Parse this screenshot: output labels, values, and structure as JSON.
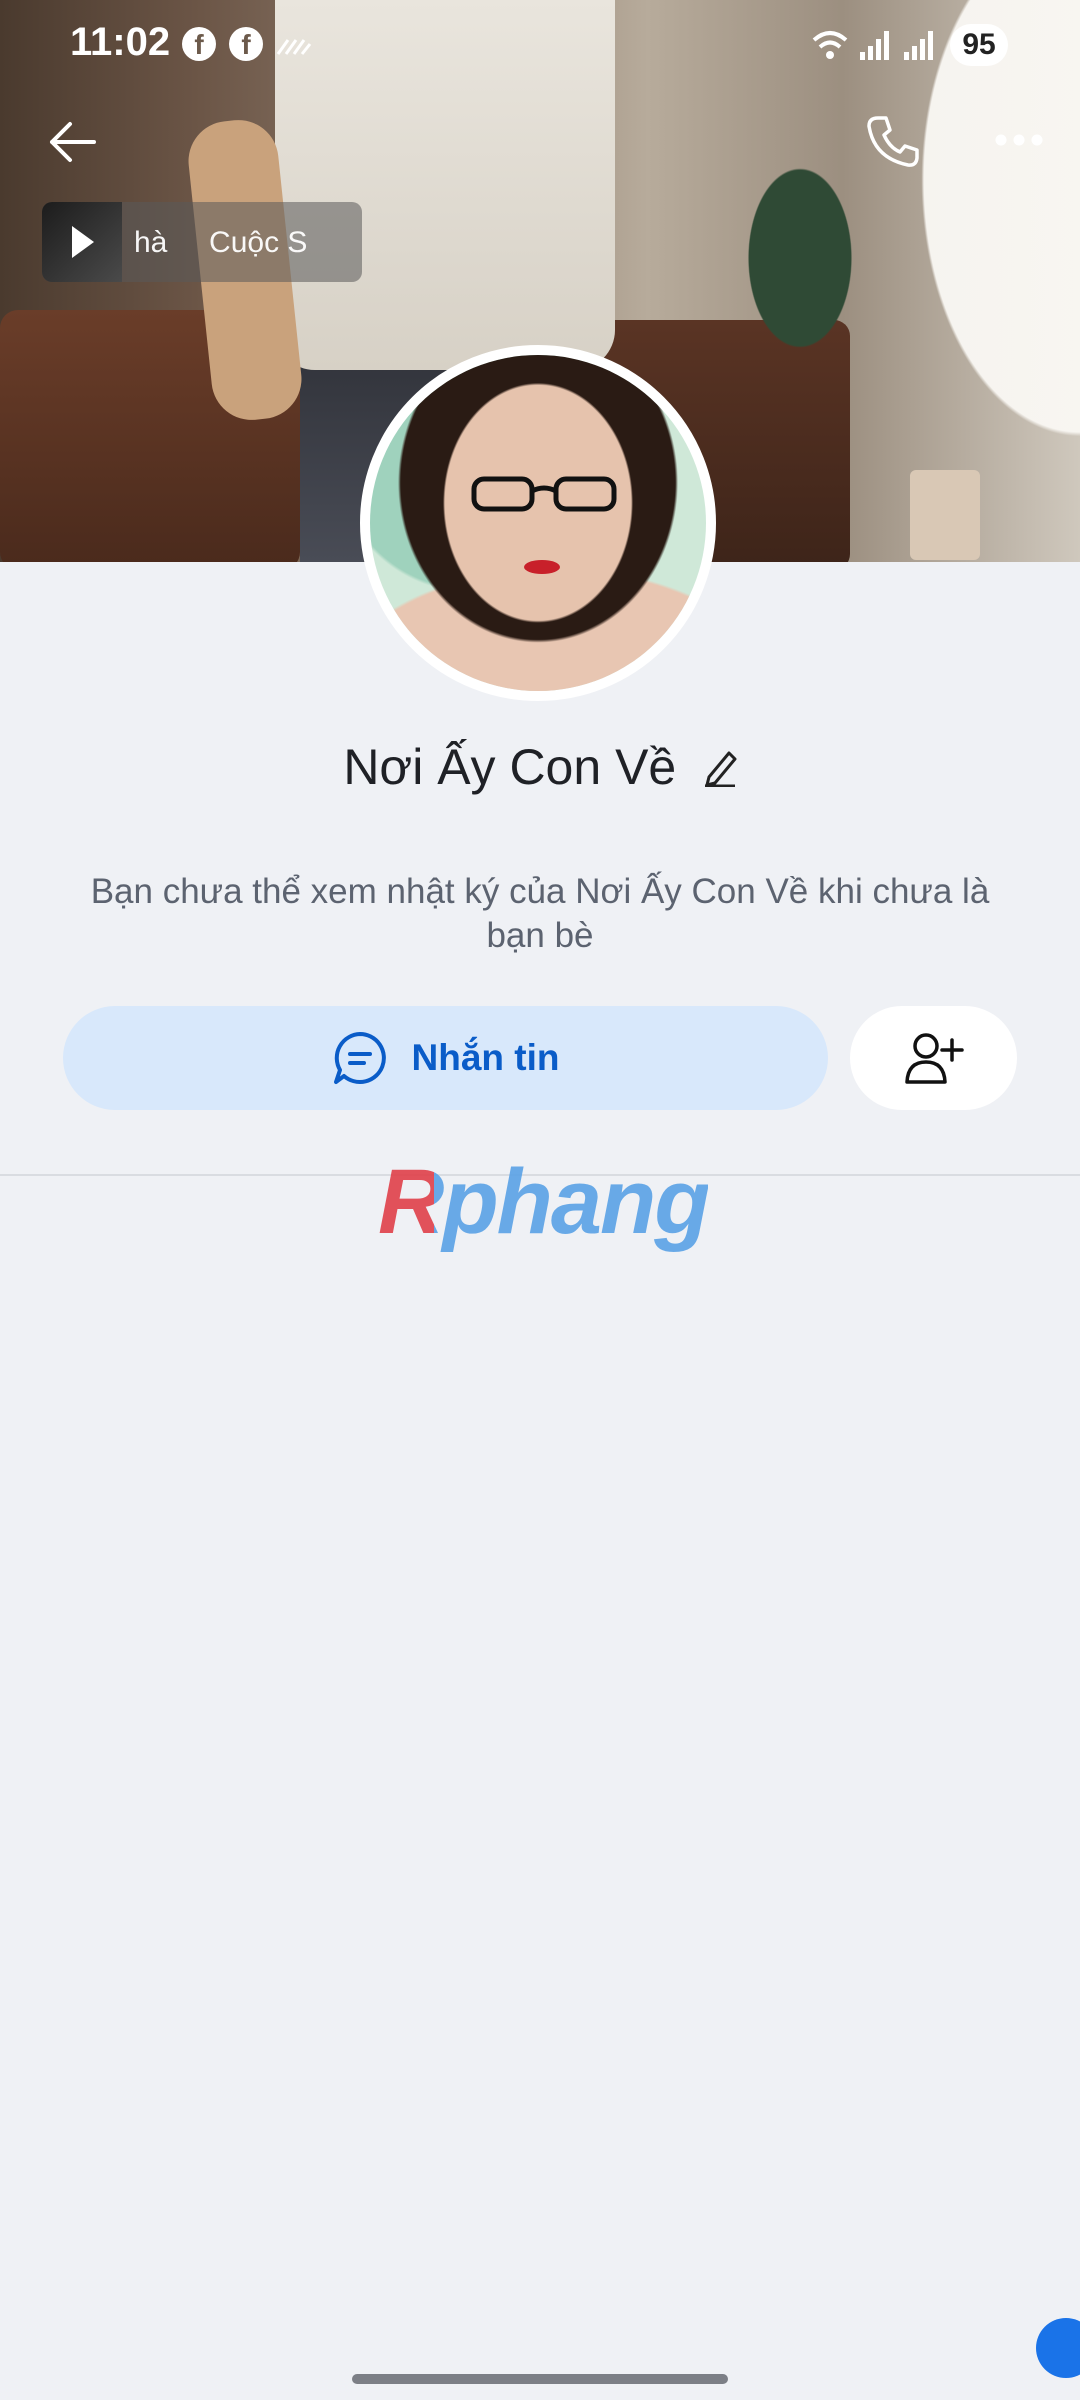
{
  "status_bar": {
    "time": "11:02",
    "notification_icons": [
      "facebook-icon",
      "facebook-icon",
      "data-saver-icon"
    ],
    "battery": "95"
  },
  "top_bar": {
    "back_icon": "arrow-left-icon",
    "call_icon": "phone-icon",
    "more_icon": "more-horizontal-icon"
  },
  "music": {
    "title": "hà     Cuộc S"
  },
  "profile": {
    "name": "Nơi Ấy Con Về",
    "notice": "Bạn chưa thể xem nhật ký của Nơi Ấy Con Về khi chưa là bạn bè"
  },
  "actions": {
    "message_label": "Nhắn tin",
    "add_friend_icon": "add-friend-icon"
  },
  "watermark": {
    "text": "Rphang"
  },
  "colors": {
    "accent": "#0a5cc8",
    "message_button_bg": "#d8e8fb",
    "page_bg": "#eff1f5"
  }
}
